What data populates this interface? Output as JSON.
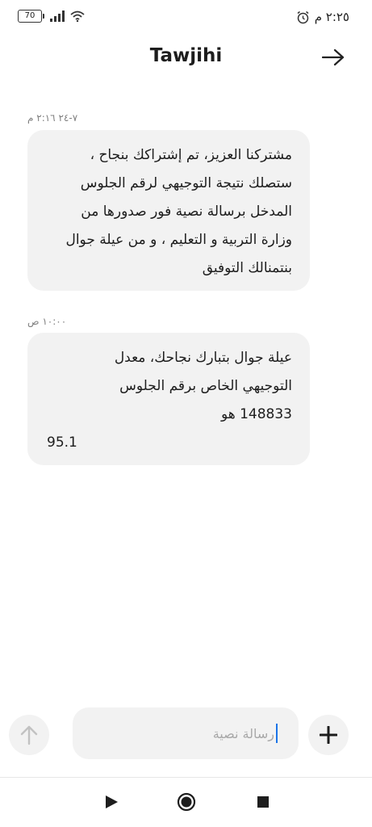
{
  "status_bar": {
    "battery_level": "70",
    "time": "٢:٢٥ م"
  },
  "header": {
    "title": "Tawjihi",
    "back_icon": "arrow-right-icon"
  },
  "messages": [
    {
      "timestamp": "٧-٢٤ ٢:١٦ م",
      "text": "مشتركنا العزيز، تم إشتراكك بنجاح ،\nستصلك نتيجة التوجيهي لرقم الجلوس\nالمدخل برسالة نصية فور صدورها من\nوزارة التربية و التعليم ، و من عيلة جوال\nبنتمنالك التوفيق",
      "extra": ""
    },
    {
      "timestamp": "١٠:٠٠ ص",
      "text": "عيلة جوال بتبارك نجاحك، معدل\nالتوجيهي الخاص برقم الجلوس\n148833 هو",
      "extra": "95.1"
    }
  ],
  "compose": {
    "placeholder": "رسالة نصية",
    "send_icon": "arrow-up-icon",
    "add_icon": "plus-icon"
  },
  "nav_bar": {
    "back_icon": "play-icon",
    "home_icon": "circle-icon",
    "recents_icon": "square-icon"
  },
  "colors": {
    "bubble": "#f2f2f2",
    "cursor": "#1a73e8",
    "timestamp": "#808080"
  }
}
